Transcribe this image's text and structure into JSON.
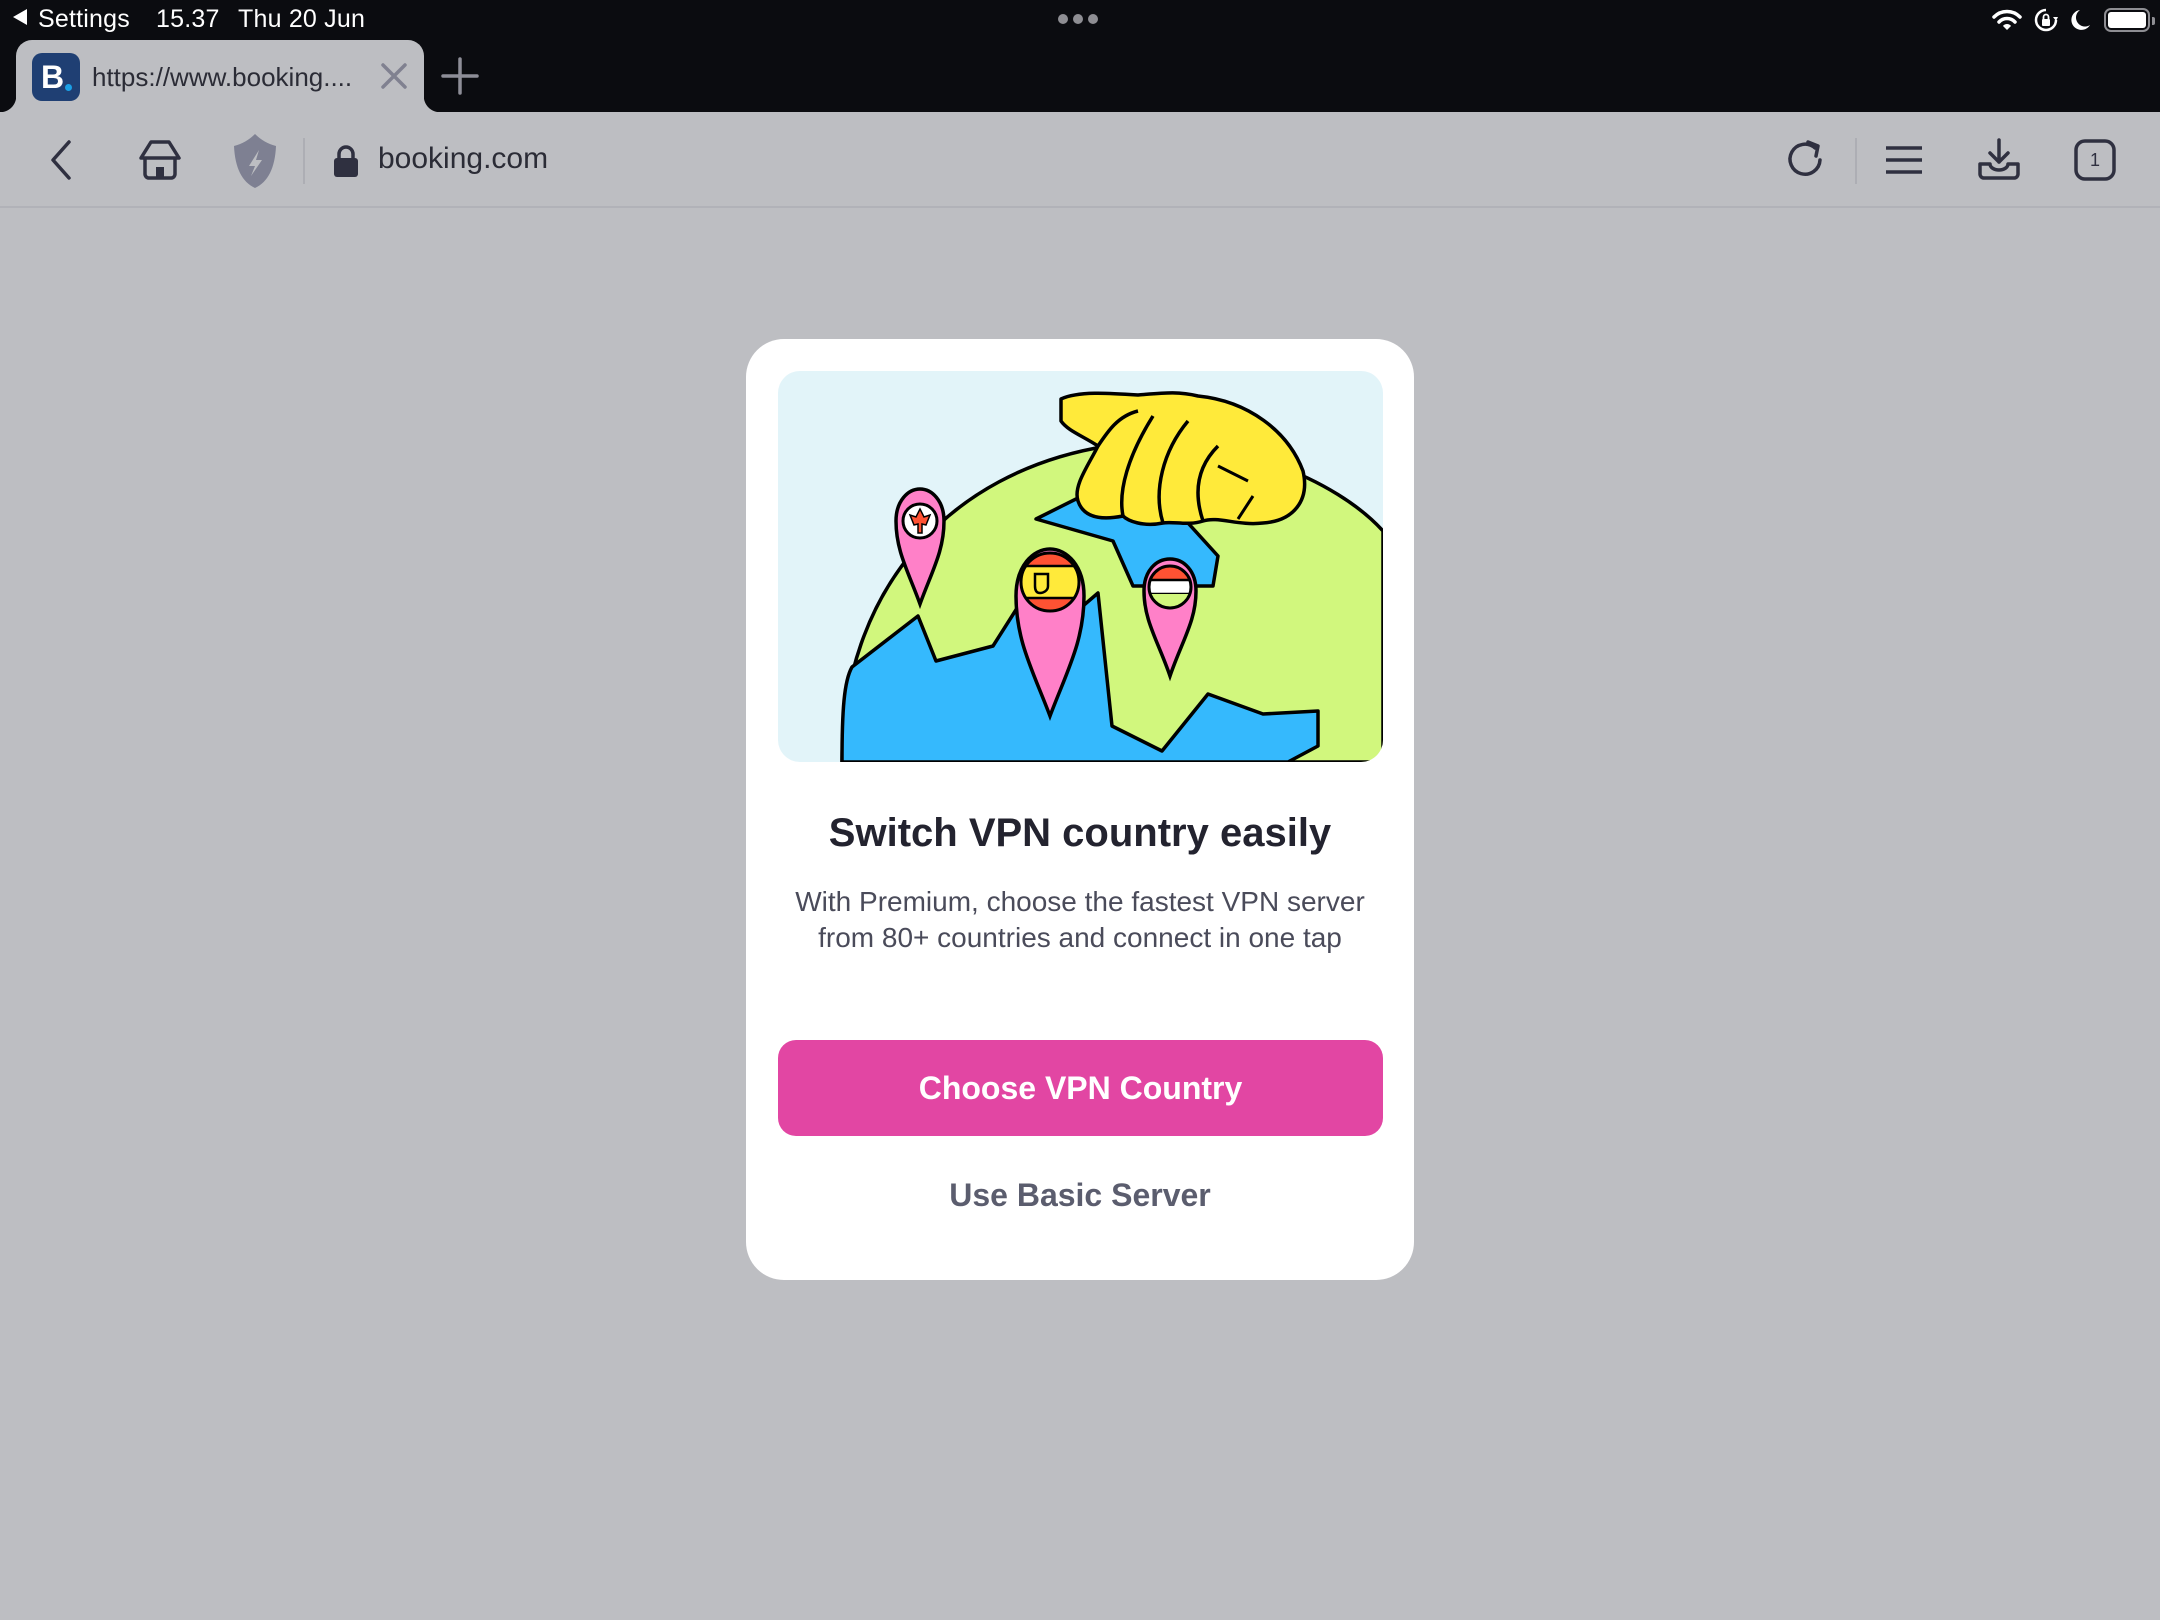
{
  "status_bar": {
    "back_app": "Settings",
    "time": "15.37",
    "date": "Thu 20 Jun",
    "icons": [
      "wifi-icon",
      "rotation-lock-icon",
      "do-not-disturb-moon-icon",
      "battery-icon"
    ],
    "battery_level": 1.0
  },
  "tab_strip": {
    "tabs": [
      {
        "favicon_letter": "B",
        "title": "https://www.booking....",
        "close_icon": "close-icon",
        "active": true
      }
    ],
    "new_tab_icon": "plus-icon"
  },
  "toolbar": {
    "left_icons": [
      "chevron-left-icon",
      "home-icon",
      "shield-bolt-icon"
    ],
    "url": "booking.com",
    "secure_icon": "lock-icon",
    "right_icons": [
      "reload-icon",
      "menu-icon",
      "download-icon",
      "tabs-count-icon"
    ],
    "tab_count": "1"
  },
  "modal": {
    "illustration": "globe-with-hand-and-country-pins",
    "title": "Switch VPN country easily",
    "body": "With Premium, choose the fastest VPN server from 80+ countries and connect in one tap",
    "primary_button": "Choose VPN Country",
    "secondary_button": "Use Basic Server",
    "accent_color": "#e246a3"
  }
}
